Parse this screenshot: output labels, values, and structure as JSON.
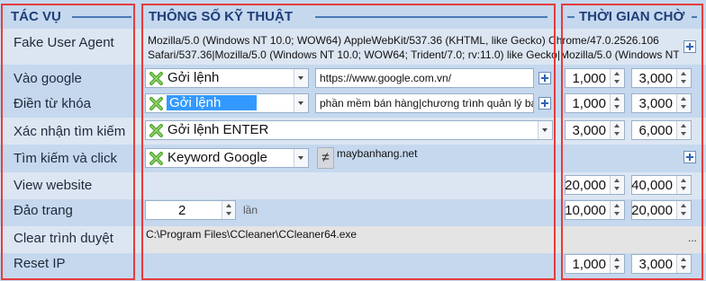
{
  "headers": {
    "tasks": "TÁC VỤ",
    "specs": "THÔNG SỐ KỸ THUẬT",
    "wait_time": "THỜI GIAN CHỜ"
  },
  "rows": {
    "fake_user_agent": {
      "label": "Fake User Agent",
      "value_line1": "Mozilla/5.0 (Windows NT 10.0; WOW64) AppleWebKit/537.36 (KHTML, like Gecko) Chrome/47.0.2526.106",
      "value_line2": "Safari/537.36|Mozilla/5.0 (Windows NT 10.0; WOW64; Trident/7.0; rv:11.0) like Gecko|Mozilla/5.0 (Windows NT"
    },
    "vao_google": {
      "label": "Vào google",
      "action": "Gởi lệnh",
      "param": "https://www.google.com.vn/",
      "wait_min": "1,000",
      "wait_max": "3,000"
    },
    "dien_tu_khoa": {
      "label": "Điền từ khóa",
      "action": "Gởi lệnh",
      "param": "phần mềm bán hàng|chương trình quản lý bá",
      "wait_min": "1,000",
      "wait_max": "3,000"
    },
    "xac_nhan": {
      "label": "Xác nhận tìm kiếm",
      "action": "Gởi lệnh ENTER",
      "wait_min": "3,000",
      "wait_max": "6,000"
    },
    "tim_kiem_click": {
      "label": "Tìm kiếm và click",
      "action": "Keyword Google",
      "operator": "≠",
      "param": "maybanhang.net"
    },
    "view_website": {
      "label": "View website",
      "wait_min": "20,000",
      "wait_max": "40,000"
    },
    "dao_trang": {
      "label": "Đảo trang",
      "count": "2",
      "unit": "lần",
      "wait_min": "10,000",
      "wait_max": "20,000"
    },
    "clear_browser": {
      "label": "Clear trình duyệt",
      "path": "C:\\Program Files\\CCleaner\\CCleaner64.exe",
      "ellipsis": "..."
    },
    "reset_ip": {
      "label": "Reset IP",
      "wait_min": "1,000",
      "wait_max": "3,000"
    }
  },
  "colors": {
    "accent": "#1f3e78",
    "highlight": "#e53c3c",
    "selection": "#3399ff",
    "background": "#c5d8ee"
  }
}
